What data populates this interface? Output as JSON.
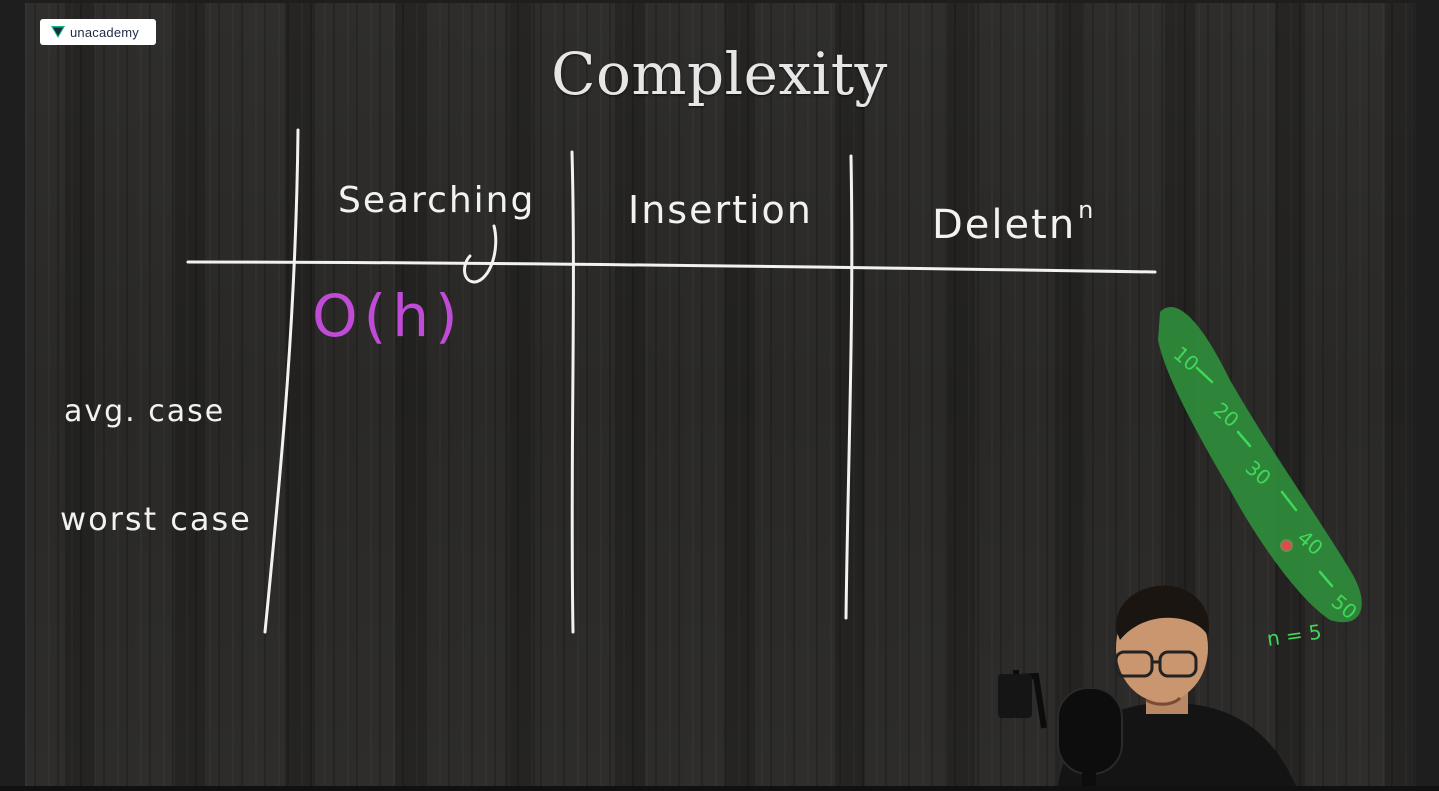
{
  "brand": {
    "logo_text": "unacademy",
    "logo_icon": "unacademy-logo-icon"
  },
  "slide": {
    "title": "Complexity"
  },
  "table": {
    "columns": [
      "Searching",
      "Insertion",
      "Deletn"
    ],
    "deletion_superscript": "n",
    "rows": [
      "avg. case",
      "worst case"
    ],
    "cells": {
      "searching_best": "O(h)"
    }
  },
  "annotation": {
    "values": [
      "10",
      "20",
      "30",
      "40",
      "50"
    ],
    "note": "n = 5",
    "highlight_color": "#2f8c3a",
    "ink_color": "#3fd85a"
  },
  "colors": {
    "purple_ink": "#c04bd6",
    "chalk": "#f2f2f2"
  },
  "presenter": {
    "icon": "presenter-webcam-icon"
  }
}
